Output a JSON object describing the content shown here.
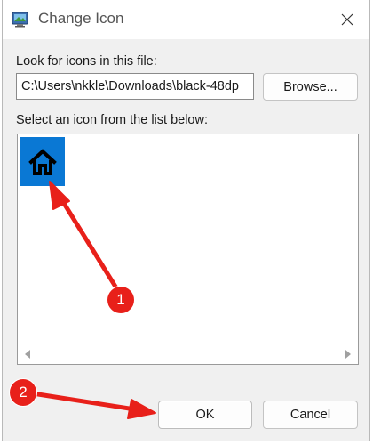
{
  "window": {
    "title": "Change Icon"
  },
  "file_section": {
    "label": "Look for icons in this file:",
    "path_value": "C:\\Users\\nkkle\\Downloads\\black-48dp",
    "browse_label": "Browse..."
  },
  "list_section": {
    "label": "Select an icon from the list below:",
    "icons": [
      {
        "icon": "home-icon",
        "selected": true
      }
    ]
  },
  "footer": {
    "ok_label": "OK",
    "cancel_label": "Cancel"
  },
  "annotations": [
    {
      "number": "1"
    },
    {
      "number": "2"
    }
  ],
  "colors": {
    "selection": "#0a78d4",
    "annotation": "#e8201a"
  }
}
